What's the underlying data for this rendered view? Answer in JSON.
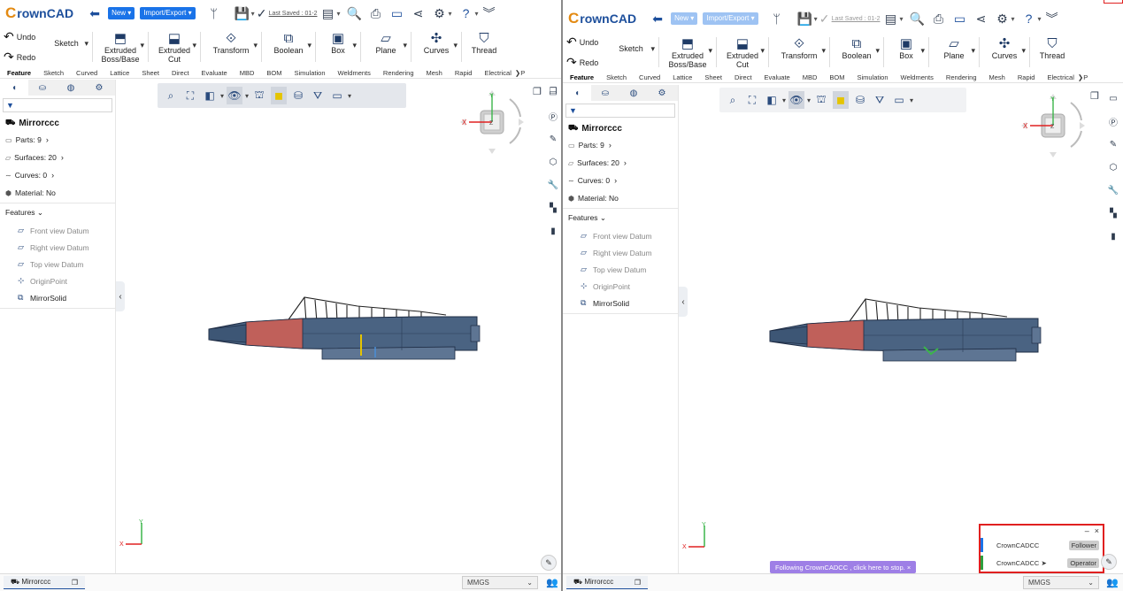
{
  "app": {
    "logo_text": "rownCAD",
    "logo_letter": "C",
    "new_label": "New",
    "import_export_label": "Import/Export",
    "last_saved_left": "Last Saved : 01-2",
    "last_saved_right": "Last Saved : 01-2"
  },
  "ribbon": {
    "undo": "Undo",
    "redo": "Redo",
    "sketch": "Sketch",
    "extruded_boss_1": "Extruded",
    "extruded_boss_2": "Boss/Base",
    "extruded_cut_1": "Extruded",
    "extruded_cut_2": "Cut",
    "transform": "Transform",
    "boolean": "Boolean",
    "box": "Box",
    "plane": "Plane",
    "curves": "Curves",
    "thread": "Thread"
  },
  "tabs": [
    "Feature",
    "Sketch",
    "Curved",
    "Lattice",
    "Sheet",
    "Direct",
    "Evaluate",
    "MBD",
    "BOM",
    "Simulation",
    "Weldments",
    "Rendering",
    "Mesh",
    "Rapid",
    "Electrical"
  ],
  "tabs_last_left": "P",
  "tabs_last_right": "P",
  "tree": {
    "document": "Mirrorccc",
    "parts": "Parts: 9",
    "surfaces": "Surfaces: 20",
    "curves": "Curves: 0",
    "material": "Material: No",
    "features_header": "Features",
    "features": [
      {
        "label": "Front view Datum",
        "icon": "datum-plane-icon"
      },
      {
        "label": "Right view Datum",
        "icon": "datum-plane-icon"
      },
      {
        "label": "Top view Datum",
        "icon": "datum-plane-icon"
      },
      {
        "label": "OriginPoint",
        "icon": "origin-point-icon"
      },
      {
        "label": "MirrorSolid",
        "icon": "mirror-solid-icon"
      }
    ]
  },
  "cube": {
    "z": "Z",
    "x": "X",
    "y": "Y"
  },
  "triad": {
    "y": "Y",
    "x": "X"
  },
  "bottom": {
    "doc_tab": "Mirrorccc",
    "units": "MMGS"
  },
  "collab": {
    "user1": "CrownCADCC",
    "role1": "Follower",
    "user2": "CrownCADCC",
    "role2": "Operator",
    "color1": "#1a73e8",
    "color2": "#2e9e3e"
  },
  "banner": "Following CrownCADCC , click here to stop.",
  "banner_close": "×"
}
